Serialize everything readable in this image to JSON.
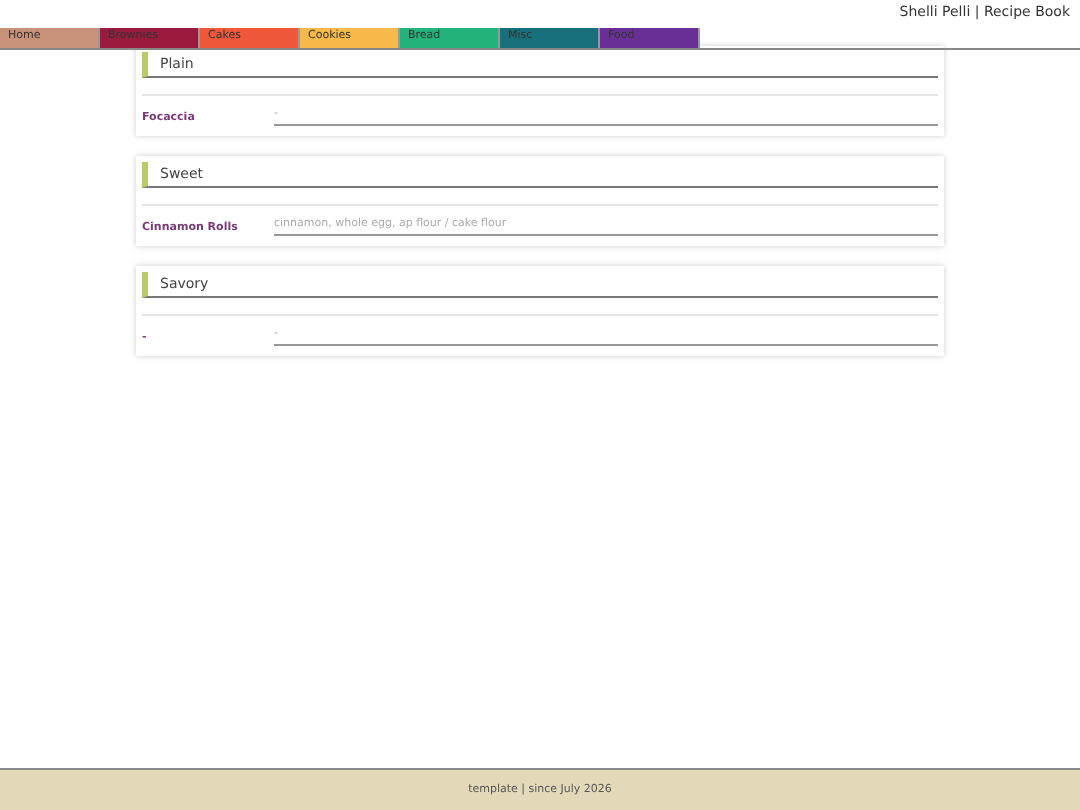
{
  "header": {
    "title": "Shelli Pelli | Recipe Book"
  },
  "tabs": [
    {
      "label": "Home",
      "color": "#c8917a"
    },
    {
      "label": "Brownies",
      "color": "#9b1b3f"
    },
    {
      "label": "Cakes",
      "color": "#f0583c"
    },
    {
      "label": "Cookies",
      "color": "#f6b94a"
    },
    {
      "label": "Bread",
      "color": "#22b47a"
    },
    {
      "label": "Misc",
      "color": "#18707c"
    },
    {
      "label": "Food",
      "color": "#6a2f96"
    }
  ],
  "sections": [
    {
      "title": "Plain",
      "recipes": [
        {
          "name": "Focaccia",
          "ingredients": "-"
        }
      ]
    },
    {
      "title": "Sweet",
      "recipes": [
        {
          "name": "Cinnamon Rolls",
          "ingredients": "cinnamon, whole egg, ap flour / cake flour"
        }
      ]
    },
    {
      "title": "Savory",
      "recipes": [
        {
          "name": "-",
          "ingredients": "-"
        }
      ]
    }
  ],
  "footer": "template | since July 2026"
}
